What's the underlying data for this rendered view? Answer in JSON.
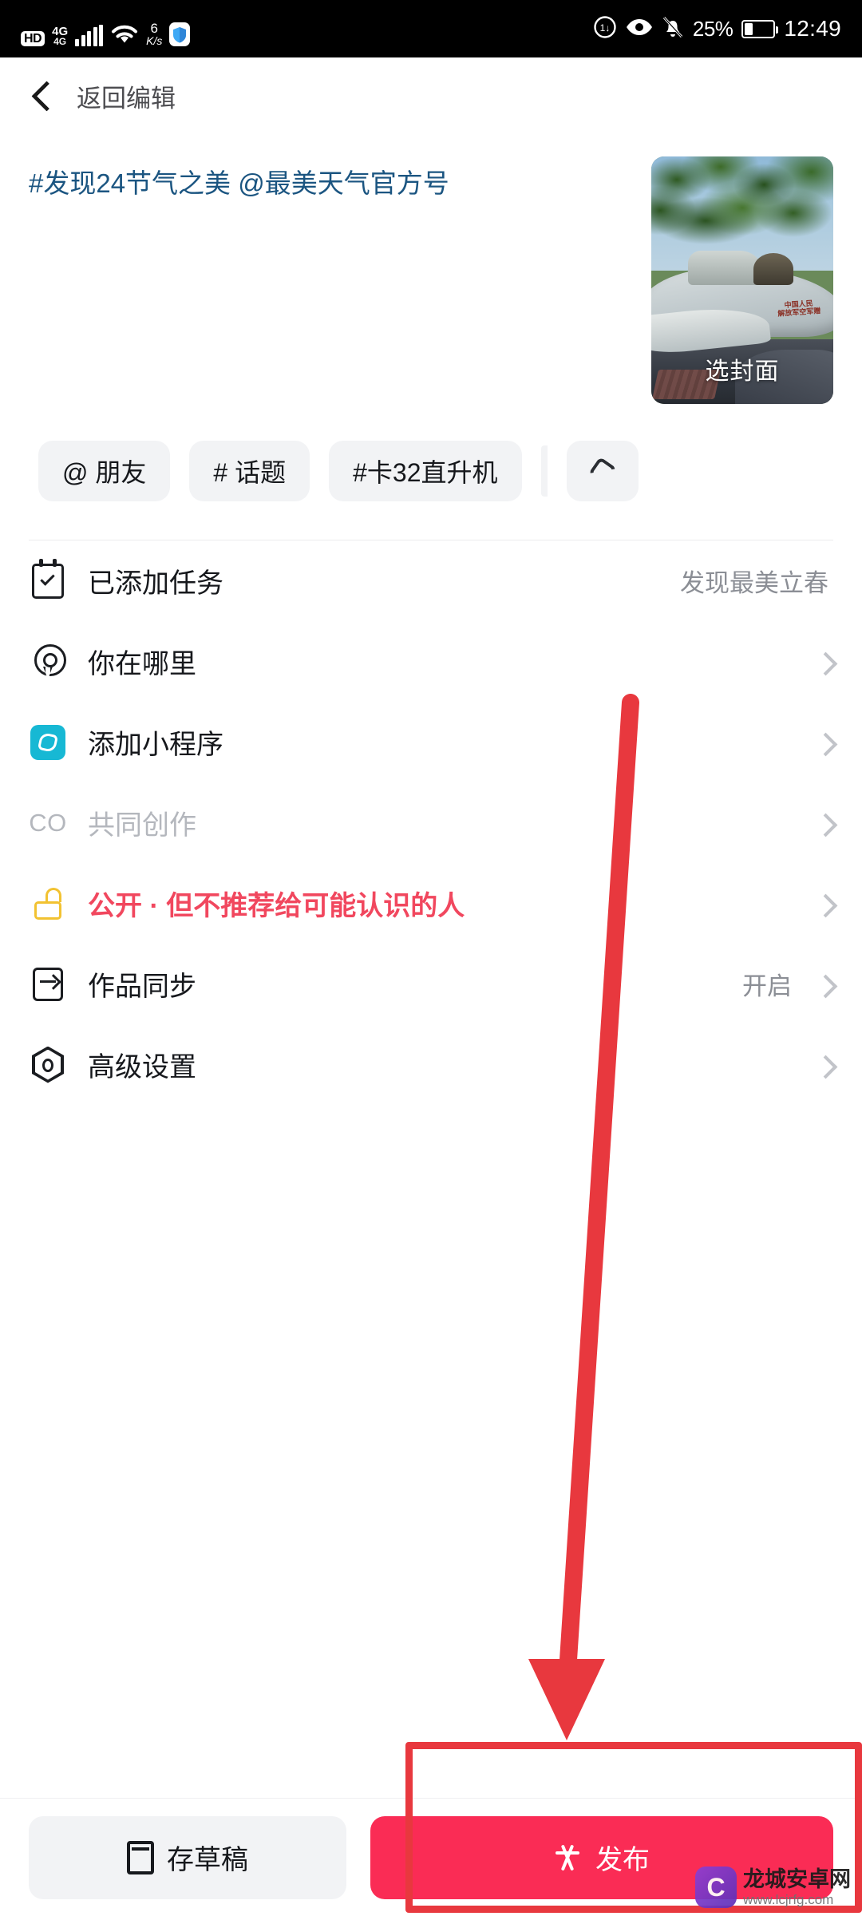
{
  "statusbar": {
    "hd": "HD",
    "network_gen": "4G",
    "network_sub": "4G",
    "speed_value": "6",
    "speed_unit": "K/s",
    "battery_percent": "25%",
    "time": "12:49",
    "icons": [
      "hd-badge",
      "signal-bars-icon",
      "wifi-icon",
      "network-speed",
      "shield-icon",
      "dnd-icon",
      "eye-comfort-icon",
      "mute-bell-icon",
      "battery-icon"
    ]
  },
  "navbar": {
    "back_label": "返回编辑"
  },
  "compose": {
    "text": "#发现24节气之美 @最美天气官方号",
    "thumb_label": "选封面",
    "thumb_plane_mark_line1": "中国人民",
    "thumb_plane_mark_line2": "解放军空军赠"
  },
  "chips": [
    {
      "label": "@ 朋友",
      "name": "chip-mention-friend"
    },
    {
      "label": "# 话题",
      "name": "chip-topic"
    },
    {
      "label": "#卡32直升机",
      "name": "chip-tag-ka32"
    }
  ],
  "chip_more": {
    "icon": "refresh-icon"
  },
  "list": [
    {
      "name": "row-added-task",
      "icon": "task-clipboard-icon",
      "label": "已添加任务",
      "value": "发现最美立春",
      "chevron": false,
      "muted": false,
      "privacy": false
    },
    {
      "name": "row-location",
      "icon": "location-pin-icon",
      "label": "你在哪里",
      "value": "",
      "chevron": true,
      "muted": false,
      "privacy": false
    },
    {
      "name": "row-mini-program",
      "icon": "mini-program-icon",
      "label": "添加小程序",
      "value": "",
      "chevron": true,
      "muted": false,
      "privacy": false
    },
    {
      "name": "row-co-creation",
      "icon": "co-icon",
      "label": "共同创作",
      "value": "",
      "chevron": true,
      "muted": true,
      "privacy": false
    },
    {
      "name": "row-privacy",
      "icon": "unlock-icon",
      "label": "公开 · 但不推荐给可能认识的人",
      "value": "",
      "chevron": true,
      "muted": false,
      "privacy": true
    },
    {
      "name": "row-work-sync",
      "icon": "sync-icon",
      "label": "作品同步",
      "value": "开启",
      "chevron": true,
      "muted": false,
      "privacy": false
    },
    {
      "name": "row-advanced-settings",
      "icon": "advanced-settings-icon",
      "label": "高级设置",
      "value": "",
      "chevron": true,
      "muted": false,
      "privacy": false
    }
  ],
  "bottombar": {
    "draft_label": "存草稿",
    "publish_label": "发布",
    "draft_icon": "save-draft-icon",
    "publish_icon": "sparkle-icon"
  },
  "annotation": {
    "arrow_color": "#e8383e",
    "highlight_color": "#e8383e"
  },
  "watermark": {
    "logo_letter": "C",
    "main": "龙城安卓网",
    "sub": "www.lcjrfg.com"
  },
  "colors": {
    "accent_publish": "#fa2c55",
    "privacy_red": "#f1475e",
    "link_blue": "#1b5581",
    "chip_bg": "#f2f3f5",
    "mini_program": "#17b8d4",
    "lock_yellow": "#f2c231"
  }
}
